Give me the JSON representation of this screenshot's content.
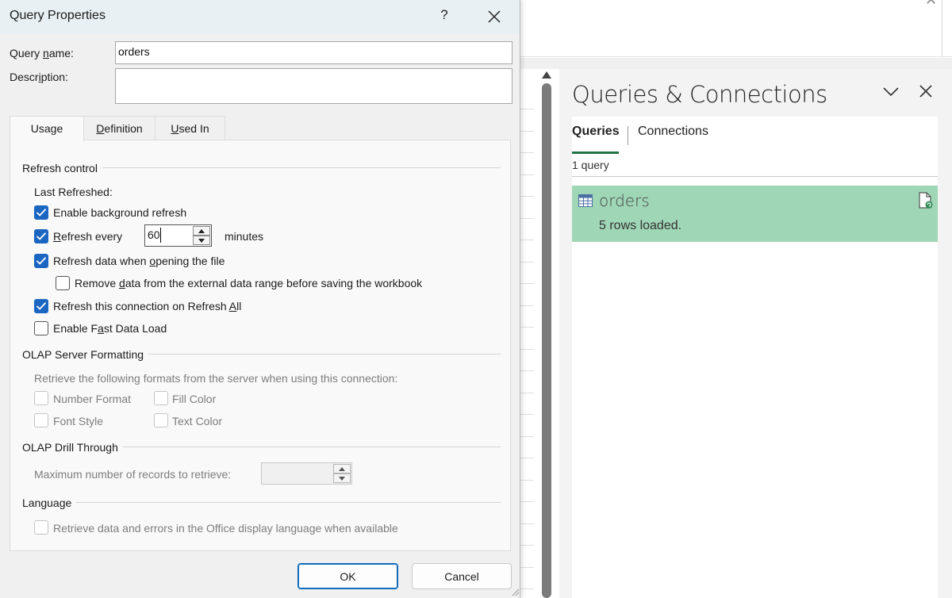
{
  "dialog": {
    "title": "Query Properties",
    "help_label": "?",
    "query_name_label_pre": "Query ",
    "query_name_label_u": "n",
    "query_name_label_post": "ame:",
    "query_name_value": "orders",
    "description_label_pre": "Descr",
    "description_label_u": "i",
    "description_label_post": "ption:",
    "description_value": "",
    "tabs": {
      "usage_pre": "Usa",
      "usage_u": "g",
      "usage_post": "e",
      "definition_u": "D",
      "definition_post": "efinition",
      "usedin_u": "U",
      "usedin_post": "sed In"
    },
    "refresh_control": {
      "heading": "Refresh control",
      "last_refreshed": "Last Refreshed:",
      "bg_refresh_pre": "Enable back",
      "bg_refresh_u": "g",
      "bg_refresh_post": "round refresh",
      "refresh_every_u": "R",
      "refresh_every_post": "efresh every",
      "refresh_every_value": "60",
      "minutes": "minutes",
      "refresh_on_open_pre": "Refresh data when ",
      "refresh_on_open_u": "o",
      "refresh_on_open_post": "pening the file",
      "remove_data_pre": "Remove ",
      "remove_data_u": "d",
      "remove_data_post": "ata from the external data range before saving the workbook",
      "refresh_all_pre": "Refresh this connection on Refresh ",
      "refresh_all_u": "A",
      "refresh_all_post": "ll",
      "fast_load_pre": "Enable F",
      "fast_load_u": "a",
      "fast_load_post": "st Data Load"
    },
    "olap_formatting": {
      "heading": "OLAP Server Formatting",
      "description": "Retrieve the following formats from the server when using this connection:",
      "number_format": "Number Format",
      "fill_color": "Fill Color",
      "font_style": "Font Style",
      "text_color": "Text Color"
    },
    "olap_drill": {
      "heading": "OLAP Drill Through",
      "max_records": "Maximum number of records to retrieve:",
      "max_records_value": ""
    },
    "language": {
      "heading": "Language",
      "retrieve_office_lang": "Retrieve data and errors in the Office display language when available"
    },
    "ok_label": "OK",
    "cancel_label": "Cancel"
  },
  "pane": {
    "title": "Queries & Connections",
    "tab_queries": "Queries",
    "tab_connections": "Connections",
    "query_count": "1 query",
    "query_name": "orders",
    "query_status": "5 rows loaded."
  },
  "colors": {
    "checkbox_checked": "#1a66c1",
    "query_item_bg": "#9fd6b5",
    "tab_underline": "#217346",
    "titlebar_bg": "#e8f0f3"
  },
  "icons": {
    "dialog_close": "close-icon",
    "pane_collapse": "chevron-down-icon",
    "pane_close": "close-icon",
    "query_item": "table-icon",
    "query_properties": "document-refresh-icon"
  }
}
